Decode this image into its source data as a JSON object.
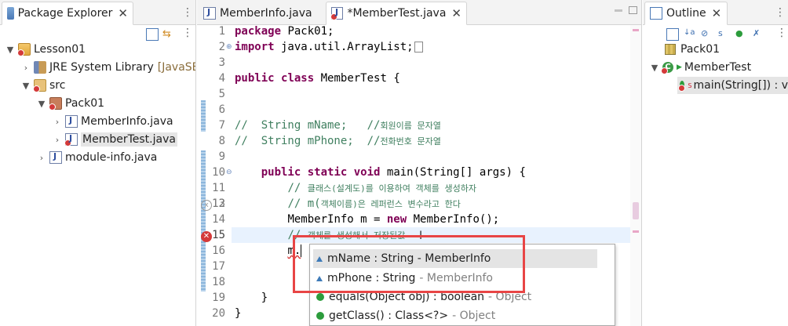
{
  "package_explorer": {
    "tab_label": "Package Explorer",
    "tree": [
      {
        "label": "Lesson01",
        "suffix": ""
      },
      {
        "label": "JRE System Library",
        "suffix": "[JavaSE-"
      },
      {
        "label": "src",
        "suffix": ""
      },
      {
        "label": "Pack01",
        "suffix": ""
      },
      {
        "label": "MemberInfo.java",
        "suffix": ""
      },
      {
        "label": "MemberTest.java",
        "suffix": ""
      },
      {
        "label": "module-info.java",
        "suffix": ""
      }
    ]
  },
  "editor": {
    "tabs": [
      {
        "label": "MemberInfo.java"
      },
      {
        "label": "*MemberTest.java"
      }
    ],
    "line_numbers": [
      "1",
      "2",
      "3",
      "4",
      "5",
      "6",
      "7",
      "8",
      "9",
      "10",
      "11",
      "12",
      "13",
      "14",
      "15",
      "16",
      "17",
      "18",
      "19",
      "20"
    ],
    "code": {
      "l1_kw": "package",
      "l1_rest": " Pack01;",
      "l2_kw": "import",
      "l2_rest": " java.util.ArrayList;",
      "l4_kw1": "public",
      "l4_kw2": "class",
      "l4_rest": " MemberTest {",
      "l7": "//  String mName;   //",
      "l7_ko": "회원이름 문자열",
      "l8": "//  String mPhone;  //",
      "l8_ko": "전화번호 문자열",
      "l10_kw1": "public",
      "l10_kw2": "static",
      "l10_kw3": "void",
      "l10_rest": " main(String[] args) {",
      "l11": "// ",
      "l11_ko": "클래스(설계도)를 이용하여 객체를 생성하자",
      "l12": "// m(",
      "l12_ko": "객체이름)은 레퍼런스 변수라고 한다",
      "l13_a": "MemberInfo m = ",
      "l13_kw": "new",
      "l13_b": " MemberInfo();",
      "l14": "// ",
      "l14_ko": "객체를 생성해서 저장된값",
      "l15": "m.",
      "l18": "}",
      "l20": "}"
    },
    "completion": [
      {
        "main": "mName : String - MemberInfo",
        "gray": ""
      },
      {
        "main": "mPhone : String",
        "gray": "- MemberInfo"
      },
      {
        "main": "equals(Object obj) : boolean",
        "gray": "- Object"
      },
      {
        "main": "getClass() : Class<?>",
        "gray": "- Object"
      }
    ]
  },
  "outline": {
    "tab_label": "Outline",
    "items": [
      {
        "label": "Pack01"
      },
      {
        "label": "MemberTest"
      },
      {
        "label": "main(String[]) : v"
      }
    ]
  },
  "colors": {
    "keyword": "#7f0055",
    "comment": "#3f7f5f",
    "error": "#d43a3a",
    "highlight_box": "#e84545"
  }
}
